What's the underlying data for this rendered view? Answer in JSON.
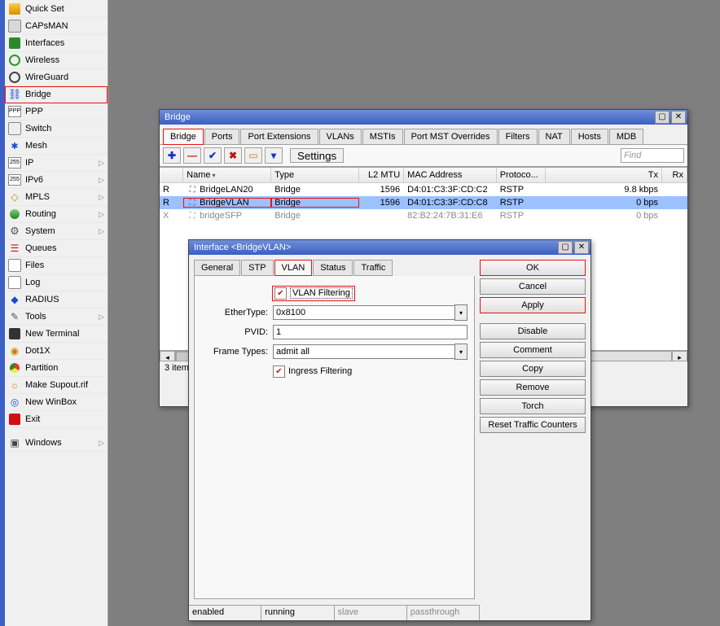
{
  "sidebar": {
    "items": [
      {
        "label": "Quick Set",
        "icon": "gold",
        "chevron": false
      },
      {
        "label": "CAPsMAN",
        "icon": "cap",
        "chevron": false
      },
      {
        "label": "Interfaces",
        "icon": "green",
        "chevron": false
      },
      {
        "label": "Wireless",
        "icon": "radio",
        "chevron": false
      },
      {
        "label": "WireGuard",
        "icon": "wg",
        "chevron": false
      },
      {
        "label": "Bridge",
        "icon": "bridge",
        "chevron": false,
        "hl": true
      },
      {
        "label": "PPP",
        "icon": "ppp",
        "chevron": false
      },
      {
        "label": "Switch",
        "icon": "switch",
        "chevron": false
      },
      {
        "label": "Mesh",
        "icon": "mesh",
        "chevron": false
      },
      {
        "label": "IP",
        "icon": "ip",
        "chevron": true
      },
      {
        "label": "IPv6",
        "icon": "ip",
        "chevron": true
      },
      {
        "label": "MPLS",
        "icon": "mpls",
        "chevron": true
      },
      {
        "label": "Routing",
        "icon": "route",
        "chevron": true
      },
      {
        "label": "System",
        "icon": "sys",
        "chevron": true
      },
      {
        "label": "Queues",
        "icon": "queue",
        "chevron": false
      },
      {
        "label": "Files",
        "icon": "files",
        "chevron": false
      },
      {
        "label": "Log",
        "icon": "log",
        "chevron": false
      },
      {
        "label": "RADIUS",
        "icon": "radius",
        "chevron": false
      },
      {
        "label": "Tools",
        "icon": "tools",
        "chevron": true
      },
      {
        "label": "New Terminal",
        "icon": "term",
        "chevron": false
      },
      {
        "label": "Dot1X",
        "icon": "dot1x",
        "chevron": false
      },
      {
        "label": "Partition",
        "icon": "part",
        "chevron": false
      },
      {
        "label": "Make Supout.rif",
        "icon": "supout",
        "chevron": false
      },
      {
        "label": "New WinBox",
        "icon": "winbox",
        "chevron": false
      },
      {
        "label": "Exit",
        "icon": "exit",
        "chevron": false
      }
    ],
    "windows_label": "Windows"
  },
  "bridge_win": {
    "title": "Bridge",
    "tabs": [
      "Bridge",
      "Ports",
      "Port Extensions",
      "VLANs",
      "MSTIs",
      "Port MST Overrides",
      "Filters",
      "NAT",
      "Hosts",
      "MDB"
    ],
    "active_tab": 0,
    "settings_label": "Settings",
    "find_placeholder": "Find",
    "columns": [
      "",
      "Name",
      "Type",
      "L2 MTU",
      "MAC Address",
      "Protoco...",
      "Tx",
      "Rx"
    ],
    "rows": [
      {
        "flag": "R",
        "name": "BridgeLAN20",
        "type": "Bridge",
        "l2": "1596",
        "mac": "D4:01:C3:3F:CD:C2",
        "proto": "RSTP",
        "tx": "9.8 kbps",
        "icon": "blue",
        "gray": false,
        "sel": false,
        "hl": false
      },
      {
        "flag": "R",
        "name": "BridgeVLAN",
        "type": "Bridge",
        "l2": "1596",
        "mac": "D4:01:C3:3F:CD:C8",
        "proto": "RSTP",
        "tx": "0 bps",
        "icon": "blue",
        "gray": false,
        "sel": true,
        "hl": true
      },
      {
        "flag": "X",
        "name": "bridgeSFP",
        "type": "Bridge",
        "l2": "",
        "mac": "82:B2:24:7B:31:E6",
        "proto": "RSTP",
        "tx": "0 bps",
        "icon": "gray",
        "gray": true,
        "sel": false,
        "hl": false
      }
    ],
    "status": "3 items"
  },
  "iface_win": {
    "title": "Interface <BridgeVLAN>",
    "tabs": [
      "General",
      "STP",
      "VLAN",
      "Status",
      "Traffic"
    ],
    "active_tab": 2,
    "vlan_filtering_label": "VLAN Filtering",
    "vlan_filtering_checked": true,
    "ether_type_label": "EtherType:",
    "ether_type_value": "0x8100",
    "pvid_label": "PVID:",
    "pvid_value": "1",
    "frame_types_label": "Frame Types:",
    "frame_types_value": "admit all",
    "ingress_filtering_label": "Ingress Filtering",
    "ingress_filtering_checked": true,
    "buttons": [
      "OK",
      "Cancel",
      "Apply",
      "Disable",
      "Comment",
      "Copy",
      "Remove",
      "Torch",
      "Reset Traffic Counters"
    ],
    "hl_buttons": [
      0,
      2
    ],
    "status": [
      "enabled",
      "running",
      "slave",
      "passthrough"
    ],
    "status_gray": [
      false,
      false,
      true,
      true
    ]
  }
}
